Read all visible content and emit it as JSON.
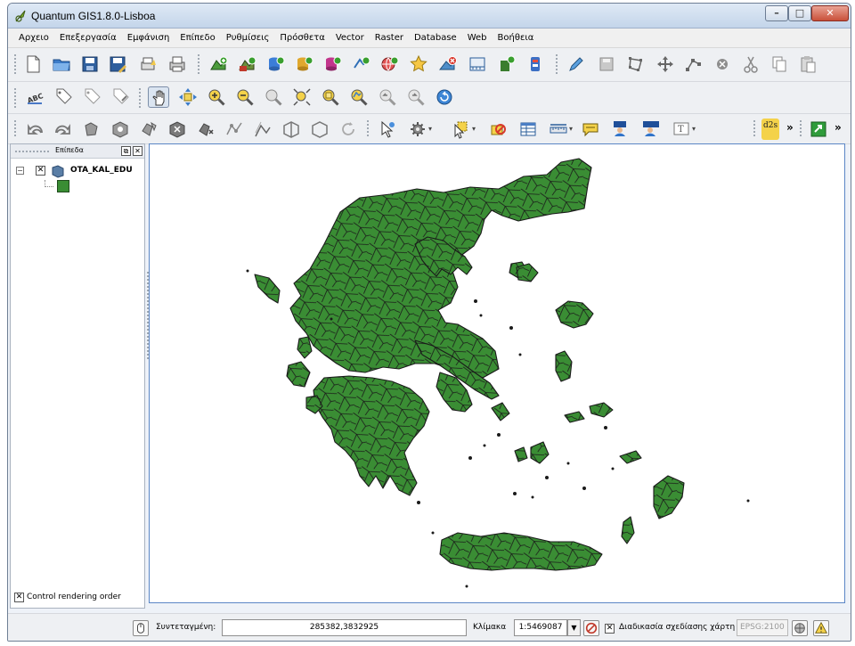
{
  "window": {
    "title": "Quantum GIS1.8.0-Lisboa"
  },
  "menu": [
    "Αρχειο",
    "Επεξεργασία",
    "Εμφάνιση",
    "Επίπεδο",
    "Ρυθμίσεις",
    "Πρόσθετα",
    "Vector",
    "Raster",
    "Database",
    "Web",
    "Βοήθεια"
  ],
  "toolbars": {
    "overflow": "»",
    "plugin_label": "d2s"
  },
  "layers_panel": {
    "title": "Επίπεδα",
    "layers": [
      {
        "name": "OTA_KAL_EDU",
        "visible": true,
        "fill": "#3a8d34"
      }
    ],
    "control_rendering_order": "Control rendering order"
  },
  "map": {
    "fill": "#3a8d34",
    "stroke": "#1a1a1a",
    "background": "#ffffff"
  },
  "statusbar": {
    "coord_label": "Συντεταγμένη:",
    "coord_value": "285382,3832925",
    "scale_label": "Κλίμακα",
    "scale_value": "1:5469087",
    "render_label": "Διαδικασία σχεδίασης χάρτη",
    "crs": "EPSG:2100"
  }
}
